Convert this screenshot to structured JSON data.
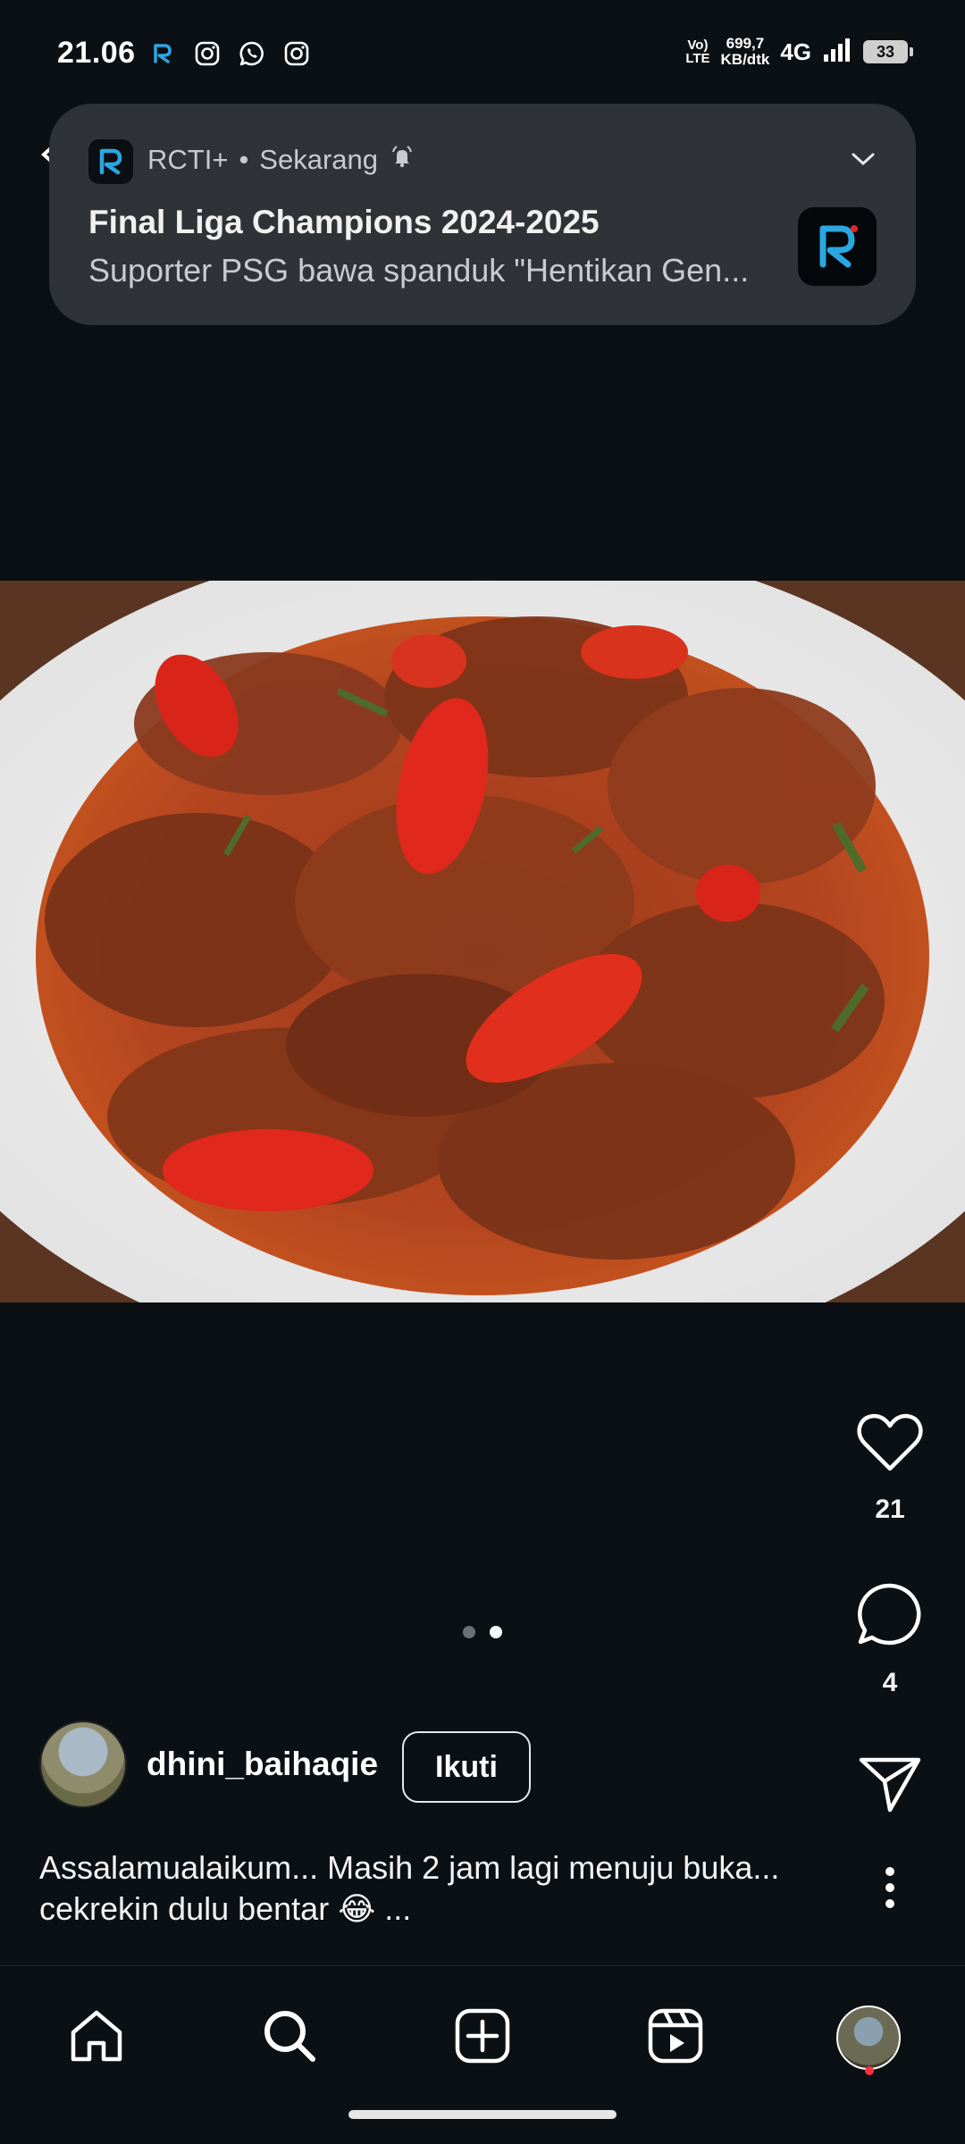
{
  "status_bar": {
    "time": "21.06",
    "volte": "VoLTE",
    "net_speed_value": "699,7",
    "net_speed_unit": "KB/dtk",
    "network": "4G",
    "battery": "33"
  },
  "notification": {
    "app_name": "RCTI+",
    "separator": "•",
    "time": "Sekarang",
    "title": "Final Liga Champions 2024-2025",
    "body": "Suporter PSG bawa spanduk \"Hentikan Gen..."
  },
  "post": {
    "carousel": {
      "total": 2,
      "active_index": 1
    },
    "likes": "21",
    "comments": "4",
    "username": "dhini_baihaqie",
    "follow_label": "Ikuti",
    "caption": "Assalamualaikum... Masih 2 jam lagi menuju buka... cekrekin dulu bentar 😂 ..."
  },
  "bottom_nav": {
    "items": [
      "home",
      "search",
      "create",
      "reels",
      "profile"
    ]
  },
  "colors": {
    "background": "#0b1014",
    "notification_bg": "#2f3236",
    "accent_red": "#ff3040",
    "rcti_blue": "#2aa7e0"
  }
}
